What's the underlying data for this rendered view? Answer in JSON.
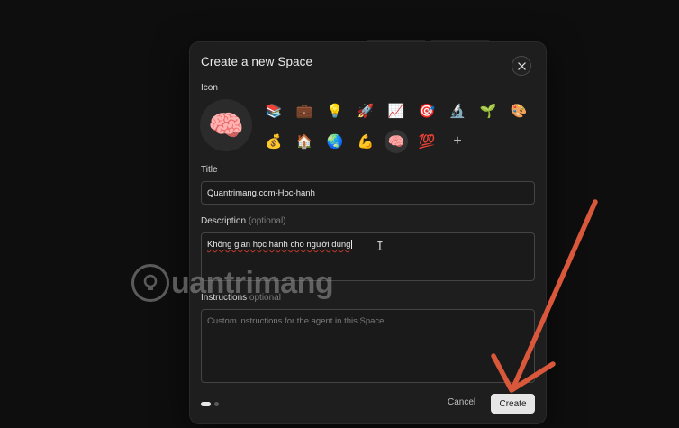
{
  "modal": {
    "title": "Create a new Space",
    "close_icon": "close-icon"
  },
  "icon_section": {
    "label": "Icon",
    "selected_icon": "🧠",
    "icons": [
      "📚",
      "💼",
      "💡",
      "🚀",
      "📈",
      "🎯",
      "🔬",
      "🌱",
      "🎨",
      "💰",
      "🏠",
      "🌏",
      "💪",
      "🧠",
      "💯"
    ],
    "add_icon": "+"
  },
  "title_section": {
    "label": "Title",
    "value": "Quantrimang.com-Hoc-hanh"
  },
  "description_section": {
    "label": "Description",
    "optional_tag": "(optional)",
    "value": "Không gian học hành cho người dùng"
  },
  "instructions_section": {
    "label": "Instructions",
    "optional_tag": "optional",
    "placeholder": "Custom instructions for the agent in this Space"
  },
  "footer": {
    "cancel_label": "Cancel",
    "create_label": "Create"
  },
  "watermark": {
    "text": "uantrimang"
  },
  "colors": {
    "backdrop": "#0d0d0d",
    "modal": "#1f1e1e",
    "primary_button": "#e6e6e6",
    "annotation_arrow": "#d9573a"
  }
}
